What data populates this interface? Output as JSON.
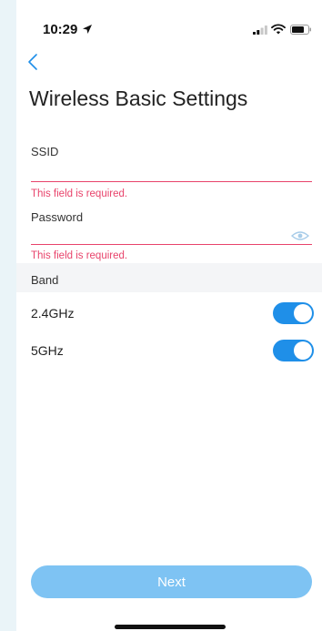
{
  "status_bar": {
    "time": "10:29"
  },
  "page": {
    "title": "Wireless Basic Settings"
  },
  "form": {
    "ssid": {
      "label": "SSID",
      "value": "",
      "error": "This field is required."
    },
    "password": {
      "label": "Password",
      "value": "",
      "error": "This field is required."
    }
  },
  "band": {
    "header": "Band",
    "options": [
      {
        "label": "2.4GHz",
        "enabled": true
      },
      {
        "label": "5GHz",
        "enabled": true
      }
    ]
  },
  "actions": {
    "next_label": "Next"
  },
  "colors": {
    "accent": "#1f8fe8",
    "error": "#e8436b",
    "button": "#7ec3f3"
  },
  "icons": [
    "location-arrow-icon",
    "signal-icon",
    "wifi-icon",
    "battery-icon",
    "back-chevron-icon",
    "eye-icon"
  ]
}
